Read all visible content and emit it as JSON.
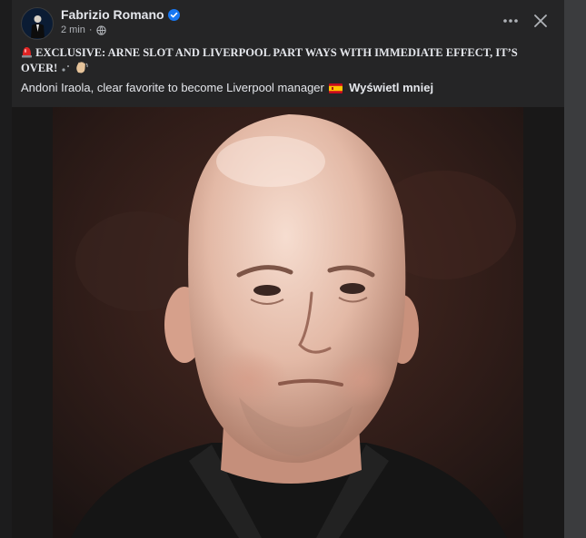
{
  "post": {
    "author": "Fabrizio Romano",
    "timestamp": "2 min",
    "headline": "EXCLUSIVE: ARNE SLOT AND LIVERPOOL PART WAYS WITH IMMEDIATE EFFECT, IT’S OVER!",
    "subline": "Andoni Iraola, clear favorite to become Liverpool manager",
    "see_less_label": "Wyświetl mniej"
  },
  "icons": {
    "verified": "verified-badge-icon",
    "privacy": "globe-icon",
    "more": "more-options-icon",
    "close": "close-icon",
    "siren": "red-siren-emoji",
    "sparkle": "sparkle-emoji",
    "wave": "waving-hand-emoji",
    "flag": "spain-flag-emoji"
  },
  "colors": {
    "background": "#1c1c1d",
    "card": "#252526",
    "text": "#e4e6eb",
    "muted": "#b0b3b8",
    "verified": "#1877f2"
  }
}
